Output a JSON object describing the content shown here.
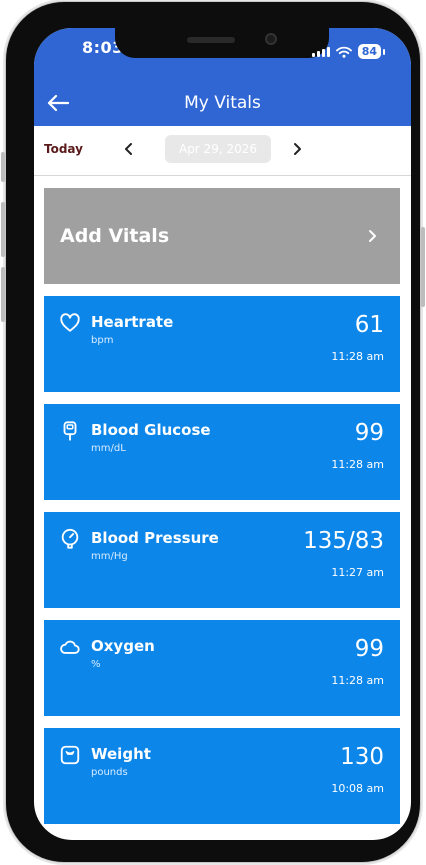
{
  "status_bar": {
    "time": "8:03",
    "battery": "84"
  },
  "header": {
    "title": "My Vitals"
  },
  "date_bar": {
    "today_label": "Today",
    "date": "Apr 29, 2026"
  },
  "add_card": {
    "label": "Add Vitals"
  },
  "vitals": [
    {
      "name": "Heartrate",
      "unit": "bpm",
      "value": "61",
      "time": "11:28 am",
      "icon": "heart-icon"
    },
    {
      "name": "Blood Glucose",
      "unit": "mm/dL",
      "value": "99",
      "time": "11:28 am",
      "icon": "glucose-meter-icon"
    },
    {
      "name": "Blood Pressure",
      "unit": "mm/Hg",
      "value": "135/83",
      "time": "11:27 am",
      "icon": "blood-pressure-gauge-icon"
    },
    {
      "name": "Oxygen",
      "unit": "%",
      "value": "99",
      "time": "11:28 am",
      "icon": "cloud-icon"
    },
    {
      "name": "Weight",
      "unit": "pounds",
      "value": "130",
      "time": "10:08 am",
      "icon": "scale-icon"
    }
  ],
  "colors": {
    "header": "#2f66d4",
    "card": "#0d86ea",
    "add_card": "#a0a0a0",
    "today": "#5a1a1a"
  }
}
